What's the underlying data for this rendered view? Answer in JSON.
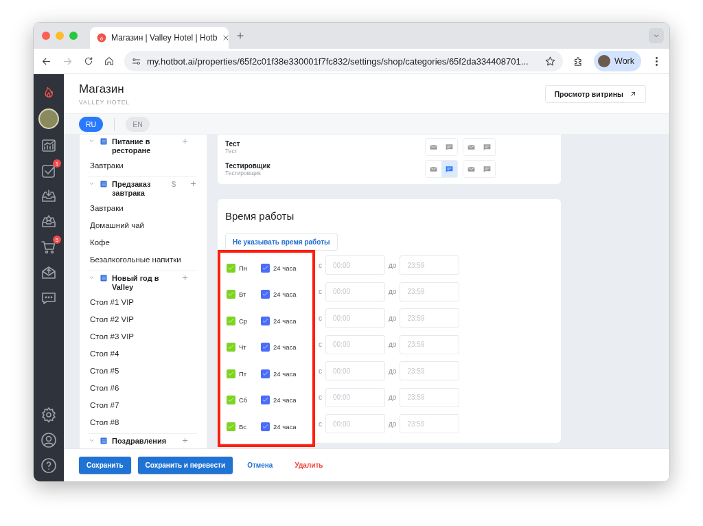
{
  "browser": {
    "tab_title": "Магазин | Valley Hotel | Hotb",
    "url": "my.hotbot.ai/properties/65f2c01f38e330001f7fc832/settings/shop/categories/65f2da334408701...",
    "profile": "Work"
  },
  "rail": {
    "items": [
      {
        "kind": "chart"
      },
      {
        "kind": "tasks",
        "badge": "1"
      },
      {
        "kind": "inbox"
      },
      {
        "kind": "reviews"
      },
      {
        "kind": "cart",
        "badge": "5"
      },
      {
        "kind": "mail"
      },
      {
        "kind": "chat"
      }
    ],
    "bottom": [
      {
        "kind": "settings"
      },
      {
        "kind": "user"
      },
      {
        "kind": "help"
      }
    ]
  },
  "header": {
    "title": "Магазин",
    "subtitle": "VALLEY HOTEL",
    "preview_button": "Просмотр витрины"
  },
  "languages": [
    {
      "label": "RU",
      "selected": true
    },
    {
      "label": "EN",
      "selected": false
    }
  ],
  "categories": [
    {
      "name": "Питание в ресторане",
      "expanded": true,
      "children": [
        {
          "name": "Завтраки"
        }
      ]
    },
    {
      "name": "Предзаказ завтрака",
      "expanded": true,
      "currency": "$",
      "children": [
        {
          "name": "Завтраки"
        },
        {
          "name": "Домашний чай"
        },
        {
          "name": "Кофе"
        },
        {
          "name": "Безалкогольные напитки"
        }
      ]
    },
    {
      "name": "Новый год в Valley",
      "expanded": true,
      "children": [
        {
          "name": "Стол #1 VIP"
        },
        {
          "name": "Стол #2 VIP"
        },
        {
          "name": "Стол #3 VIP"
        },
        {
          "name": "Стол #4"
        },
        {
          "name": "Стол #5"
        },
        {
          "name": "Стол #6"
        },
        {
          "name": "Стол #7"
        },
        {
          "name": "Стол #8"
        }
      ]
    },
    {
      "name": "Поздравления",
      "expanded": true
    }
  ],
  "notifications": [
    {
      "name": "Тест",
      "role": "Тест",
      "groups": [
        {
          "channels": [
            {
              "kind": "email",
              "selected": false
            },
            {
              "kind": "chat",
              "selected": false
            }
          ]
        },
        {
          "channels": [
            {
              "kind": "email",
              "selected": false
            },
            {
              "kind": "chat",
              "selected": false
            }
          ]
        }
      ]
    },
    {
      "name": "Тестировщик",
      "role": "Тестировщик",
      "groups": [
        {
          "channels": [
            {
              "kind": "email",
              "selected": false
            },
            {
              "kind": "chat",
              "selected": true
            }
          ]
        },
        {
          "channels": [
            {
              "kind": "email",
              "selected": false
            },
            {
              "kind": "chat",
              "selected": false
            }
          ]
        }
      ]
    }
  ],
  "hours": {
    "title": "Время работы",
    "no_hours_button": "Не указывать время работы",
    "days": [
      {
        "day": "Пн",
        "enabled": true,
        "all_day_label": "24 часа",
        "all_day": true,
        "from_label": "с",
        "from": "00:00",
        "to_label": "до",
        "to": "23:59"
      },
      {
        "day": "Вт",
        "enabled": true,
        "all_day_label": "24 часа",
        "all_day": true,
        "from_label": "с",
        "from": "00:00",
        "to_label": "до",
        "to": "23:59"
      },
      {
        "day": "Ср",
        "enabled": true,
        "all_day_label": "24 часа",
        "all_day": true,
        "from_label": "с",
        "from": "00:00",
        "to_label": "до",
        "to": "23:59"
      },
      {
        "day": "Чт",
        "enabled": true,
        "all_day_label": "24 часа",
        "all_day": true,
        "from_label": "с",
        "from": "00:00",
        "to_label": "до",
        "to": "23:59"
      },
      {
        "day": "Пт",
        "enabled": true,
        "all_day_label": "24 часа",
        "all_day": true,
        "from_label": "с",
        "from": "00:00",
        "to_label": "до",
        "to": "23:59"
      },
      {
        "day": "Сб",
        "enabled": true,
        "all_day_label": "24 часа",
        "all_day": true,
        "from_label": "с",
        "from": "00:00",
        "to_label": "до",
        "to": "23:59"
      },
      {
        "day": "Вс",
        "enabled": true,
        "all_day_label": "24 часа",
        "all_day": true,
        "from_label": "с",
        "from": "00:00",
        "to_label": "до",
        "to": "23:59"
      }
    ]
  },
  "footer": {
    "buttons": [
      {
        "label": "Сохранить",
        "kind": "primary"
      },
      {
        "label": "Сохранить и перевести",
        "kind": "primary"
      },
      {
        "label": "Отмена",
        "kind": "link"
      },
      {
        "label": "Удалить",
        "kind": "danger"
      }
    ]
  }
}
